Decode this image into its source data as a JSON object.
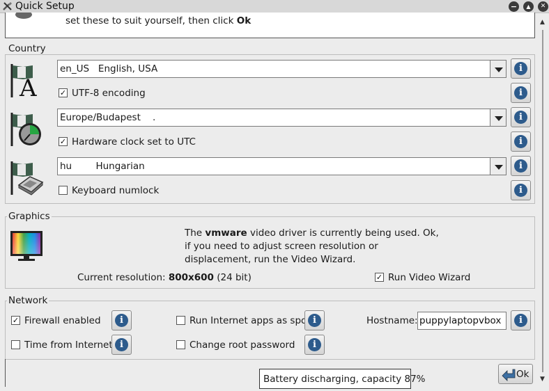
{
  "window": {
    "title": "Quick Setup",
    "buttons": [
      "−",
      "▲",
      "✕"
    ]
  },
  "intro": {
    "text_prefix": "set these to suit yourself, then click ",
    "text_bold": "Ok"
  },
  "country": {
    "label": "Country",
    "locale": {
      "value": "en_US   English, USA"
    },
    "utf8": {
      "label": "UTF-8 encoding",
      "checked": true
    },
    "timezone": {
      "value": "Europe/Budapest    ."
    },
    "hwclock": {
      "label": "Hardware clock set to UTC",
      "checked": true
    },
    "keyboard": {
      "value": "hu        Hungarian"
    },
    "numlock": {
      "label": "Keyboard numlock",
      "checked": false
    }
  },
  "graphics": {
    "label": "Graphics",
    "line1_a": "The ",
    "line1_b": "vmware",
    "line1_c": " video driver is currently being used. Ok,",
    "line2": "if you need to adjust screen resolution or",
    "line3": "displacement, run the Video Wizard.",
    "res_prefix": "Current resolution: ",
    "res_value": "800x600",
    "res_suffix": "  (24 bit)",
    "wizard": {
      "label": "Run Video Wizard",
      "checked": true
    }
  },
  "network": {
    "label": "Network",
    "firewall": {
      "label": "Firewall enabled",
      "checked": true
    },
    "spot": {
      "label": "Run Internet apps as spot",
      "checked": false
    },
    "hostname_label": "Hostname:",
    "hostname_value": "puppylaptopvbox",
    "timeinternet": {
      "label": "Time from Internet",
      "checked": false
    },
    "rootpw": {
      "label": "Change root password",
      "checked": false
    }
  },
  "info_icon": "i",
  "ok_button": {
    "label": "Ok"
  },
  "tooltip": {
    "text": "Battery discharging, capacity 87%"
  },
  "icons": [
    "settings-icon",
    "language-flag-icon",
    "clock-flag-icon",
    "keyboard-flag-icon",
    "monitor-icon",
    "ok-arrow-icon"
  ],
  "colors": {
    "info_blue": "#2d5b8c",
    "background": "#ececec"
  }
}
